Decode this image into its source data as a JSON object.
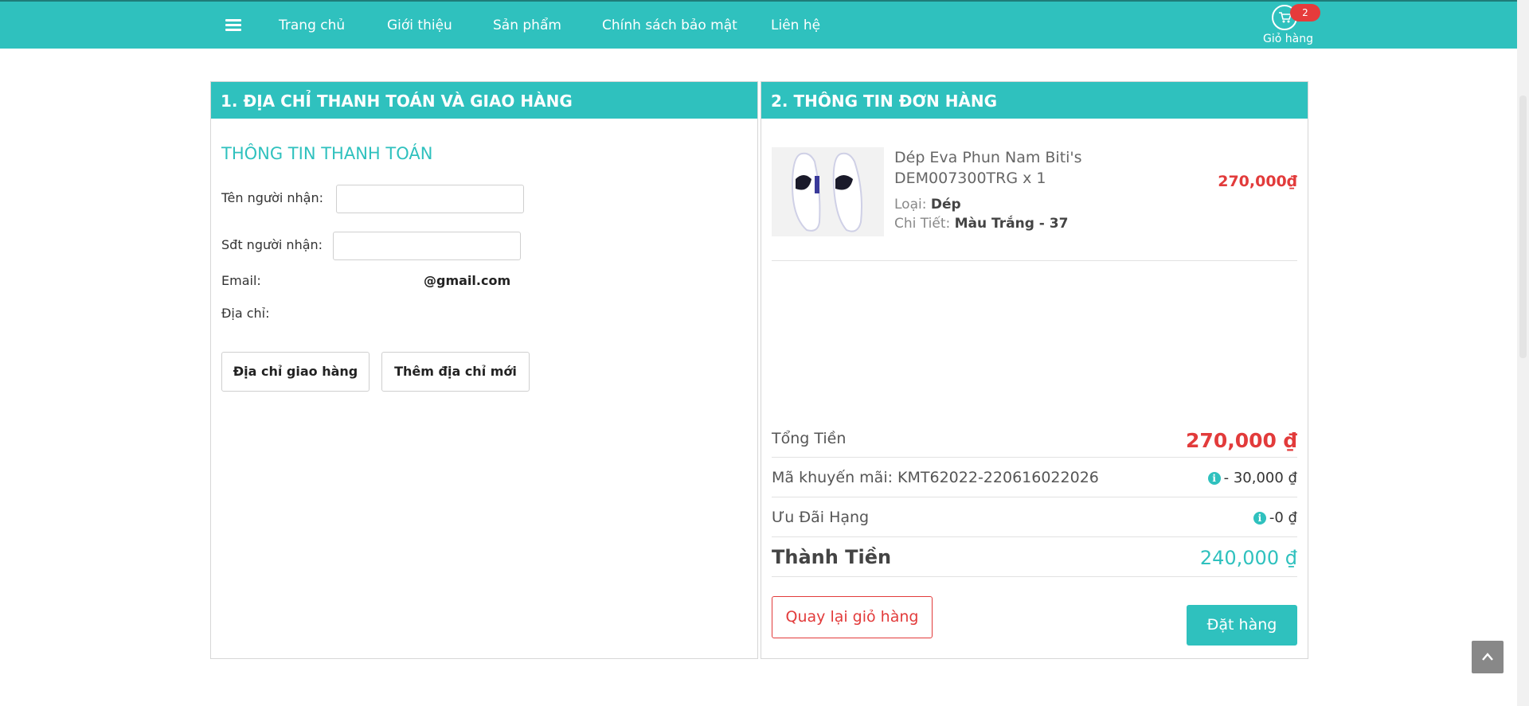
{
  "nav": {
    "items": [
      "Trang chủ",
      "Giới thiệu",
      "Sản phẩm",
      "Chính sách bảo mật",
      "Liên hệ"
    ],
    "cart_count": "2",
    "cart_label": "Giỏ hàng"
  },
  "billing": {
    "header": "1. ĐỊA CHỈ THANH TOÁN VÀ GIAO HÀNG",
    "section_title": "THÔNG TIN THANH TOÁN",
    "recipient_name_label": "Tên người nhận:",
    "recipient_name_value": "",
    "recipient_phone_label": "Sđt người nhận:",
    "recipient_phone_value": "",
    "email_label": "Email:",
    "email_value": "@gmail.com",
    "address_label": "Địa chỉ:",
    "shipping_address_button": "Địa chỉ giao hàng",
    "new_address_button": "Thêm địa chỉ mới"
  },
  "order": {
    "header": "2. THÔNG TIN ĐƠN HÀNG",
    "product": {
      "name": "Dép Eva Phun Nam Biti's DEM007300TRG x 1",
      "type_label": "Loại:",
      "type_value": "Dép",
      "detail_label": "Chi Tiết:",
      "detail_value": "Màu Trắng - 37",
      "price": "270,000₫"
    },
    "total_label": "Tổng Tiền",
    "total_value": "270,000 ₫",
    "promo_label": "Mã khuyến mãi: KMT62022-220616022026",
    "promo_value": "- 30,000 ₫",
    "rank_label": "Ưu Đãi Hạng",
    "rank_value": "-0 ₫",
    "final_label": "Thành Tiền",
    "final_value": "240,000 ₫",
    "back_button": "Quay lại giỏ hàng",
    "order_button": "Đặt hàng"
  },
  "colors": {
    "accent": "#2fc1be",
    "price_red": "#e23b3b"
  }
}
